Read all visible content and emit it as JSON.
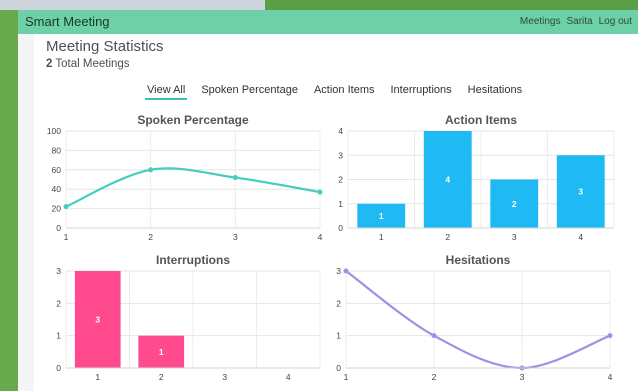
{
  "app": {
    "brand": "Smart Meeting",
    "nav": [
      "Meetings",
      "Sarita",
      "Log out"
    ]
  },
  "header": {
    "title": "Meeting Statistics",
    "count": "2",
    "count_label": "Total Meetings"
  },
  "tabs": [
    "View All",
    "Spoken Percentage",
    "Action Items",
    "Interruptions",
    "Hesitations"
  ],
  "colors": {
    "navbar": "#6dd0a7",
    "spoken_line": "#48cbc0",
    "action_bar": "#1fb9f3",
    "interrupt_bar": "#ff4b8d",
    "hesitation_line": "#a48de6"
  },
  "chart_data": [
    {
      "type": "line",
      "title": "Spoken Percentage",
      "x": [
        1,
        2,
        3,
        4
      ],
      "values": [
        22,
        60,
        52,
        37
      ],
      "ylim": [
        0,
        100
      ],
      "yticks": [
        0,
        20,
        40,
        60,
        80,
        100
      ]
    },
    {
      "type": "bar",
      "title": "Action Items",
      "categories": [
        "1",
        "2",
        "3",
        "4"
      ],
      "values": [
        1,
        4,
        2,
        3
      ],
      "ylim": [
        0,
        4
      ],
      "yticks": [
        0,
        1,
        2,
        3,
        4
      ]
    },
    {
      "type": "bar",
      "title": "Interruptions",
      "categories": [
        "1",
        "2",
        "3",
        "4"
      ],
      "values": [
        3,
        1,
        0,
        0
      ],
      "ylim": [
        0,
        3
      ],
      "yticks": [
        0,
        1,
        2,
        3
      ]
    },
    {
      "type": "line",
      "title": "Hesitations",
      "x": [
        1,
        2,
        3,
        4
      ],
      "values": [
        3,
        1,
        0,
        1
      ],
      "ylim": [
        0,
        3
      ],
      "yticks": [
        0,
        1,
        2,
        3
      ]
    }
  ]
}
